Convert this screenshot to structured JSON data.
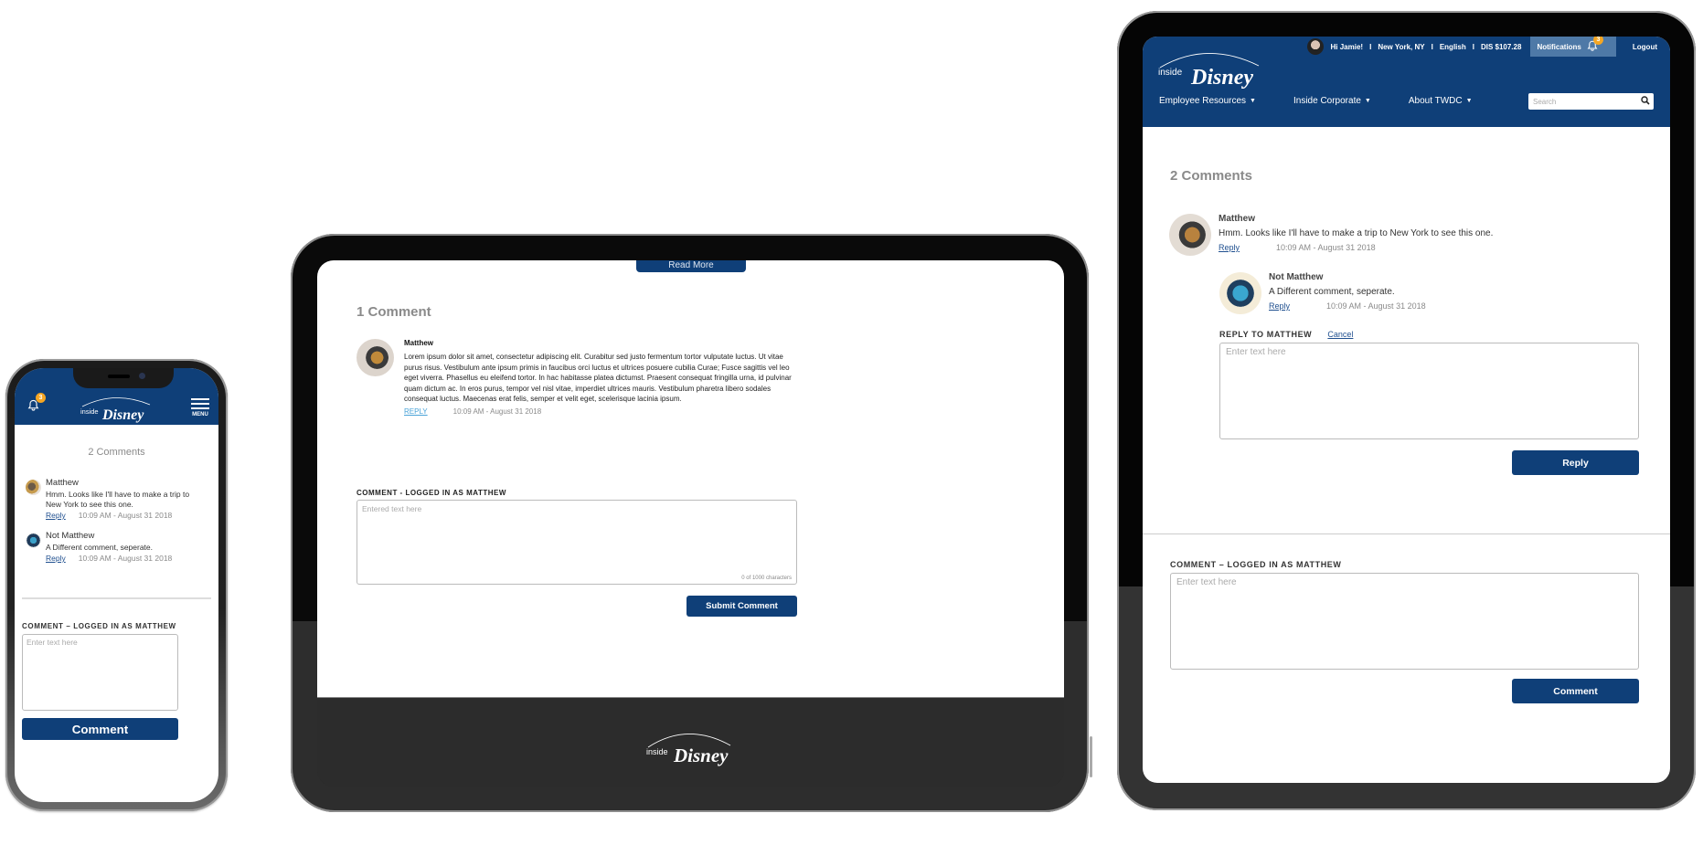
{
  "brand": {
    "logo_small": "inside",
    "logo_large": "DISNEY",
    "navy": "#0f3f78",
    "badge_color": "#f5a623"
  },
  "phone": {
    "notification_count": "3",
    "menu_label": "MENU",
    "comment_count_label": "2 Comments",
    "comments": [
      {
        "author": "Matthew",
        "text": "Hmm. Looks like I'll have to make a trip to New York to see this one.",
        "reply_label": "Reply",
        "timestamp": "10:09 AM - August 31 2018"
      },
      {
        "author": "Not Matthew",
        "text": "A Different comment, seperate.",
        "reply_label": "Reply",
        "timestamp": "10:09 AM - August 31 2018"
      }
    ],
    "form_label": "COMMENT – LOGGED IN AS MATTHEW",
    "placeholder": "Enter text here",
    "submit_label": "Comment"
  },
  "landscape": {
    "read_more_label": "Read More",
    "comment_count_label": "1 Comment",
    "comment": {
      "author": "Matthew",
      "text": "Lorem ipsum dolor sit amet, consectetur adipiscing elit. Curabitur sed justo fermentum tortor vulputate luctus. Ut vitae purus risus. Vestibulum ante ipsum primis in faucibus orci luctus et ultrices posuere cubilia Curae; Fusce sagittis vel leo eget viverra. Phasellus eu eleifend tortor. In hac habitasse platea dictumst. Praesent consequat fringilla urna, id pulvinar quam dictum ac. In eros purus, tempor vel nisl vitae, imperdiet ultrices mauris. Vestibulum pharetra libero sodales consequat luctus. Maecenas erat felis, semper et velit eget, scelerisque lacinia ipsum.",
      "reply_label": "REPLY",
      "timestamp": "10:09 AM - August 31 2018"
    },
    "form_label": "COMMENT - LOGGED IN AS MATTHEW",
    "placeholder": "Entered text here",
    "char_counter": "0 of 1000 characters",
    "submit_label": "Submit Comment"
  },
  "portrait": {
    "utility": {
      "greeting": "Hi Jamie!",
      "location": "New York, NY",
      "language": "English",
      "stock": "DIS $107.28",
      "notifications_label": "Notifications",
      "notification_count": "3",
      "logout_label": "Logout",
      "separator": "I"
    },
    "nav": [
      {
        "label": "Employee Resources"
      },
      {
        "label": "Inside Corporate"
      },
      {
        "label": "About TWDC"
      }
    ],
    "search_placeholder": "Search",
    "comment_count_label": "2 Comments",
    "comments": [
      {
        "author": "Matthew",
        "text": "Hmm. Looks like I'll have to make a trip to New York to see this one.",
        "reply_label": "Reply",
        "timestamp": "10:09 AM - August 31 2018"
      },
      {
        "author": "Not Matthew",
        "text": "A Different comment, seperate.",
        "reply_label": "Reply",
        "timestamp": "10:09 AM - August 31 2018"
      }
    ],
    "reply_form": {
      "label": "REPLY TO MATTHEW",
      "cancel_label": "Cancel",
      "placeholder": "Enter text here",
      "submit_label": "Reply"
    },
    "comment_form": {
      "label": "COMMENT – LOGGED IN AS MATTHEW",
      "placeholder": "Enter text here",
      "submit_label": "Comment"
    }
  }
}
